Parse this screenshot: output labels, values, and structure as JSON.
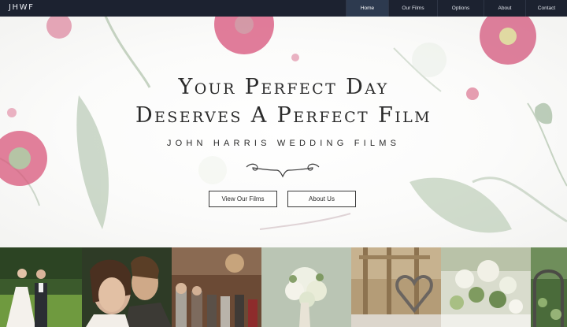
{
  "brand": "JHWF",
  "nav": {
    "items": [
      {
        "label": "Home",
        "active": true
      },
      {
        "label": "Our Films",
        "active": false
      },
      {
        "label": "Options",
        "active": false
      },
      {
        "label": "About",
        "active": false
      },
      {
        "label": "Contact",
        "active": false
      }
    ]
  },
  "hero": {
    "title_line1": "Your Perfect Day",
    "title_line2": "Deserves A Perfect Film",
    "subtitle": "JOHN HARRIS WEDDING FILMS",
    "buttons": {
      "films": "View Our Films",
      "about": "About Us"
    }
  },
  "colors": {
    "nav_bg": "#1c2230",
    "nav_active": "#2d3a4f",
    "flower_pink": "#cf3e66",
    "leaf_green": "#9fb59a"
  },
  "gallery": [
    "bride-walking-photo",
    "couple-portrait-photo",
    "ceremony-guests-photo",
    "bridal-bouquet-photo",
    "heart-chair-decoration-photo",
    "table-flowers-photo",
    "garden-arch-photo"
  ]
}
